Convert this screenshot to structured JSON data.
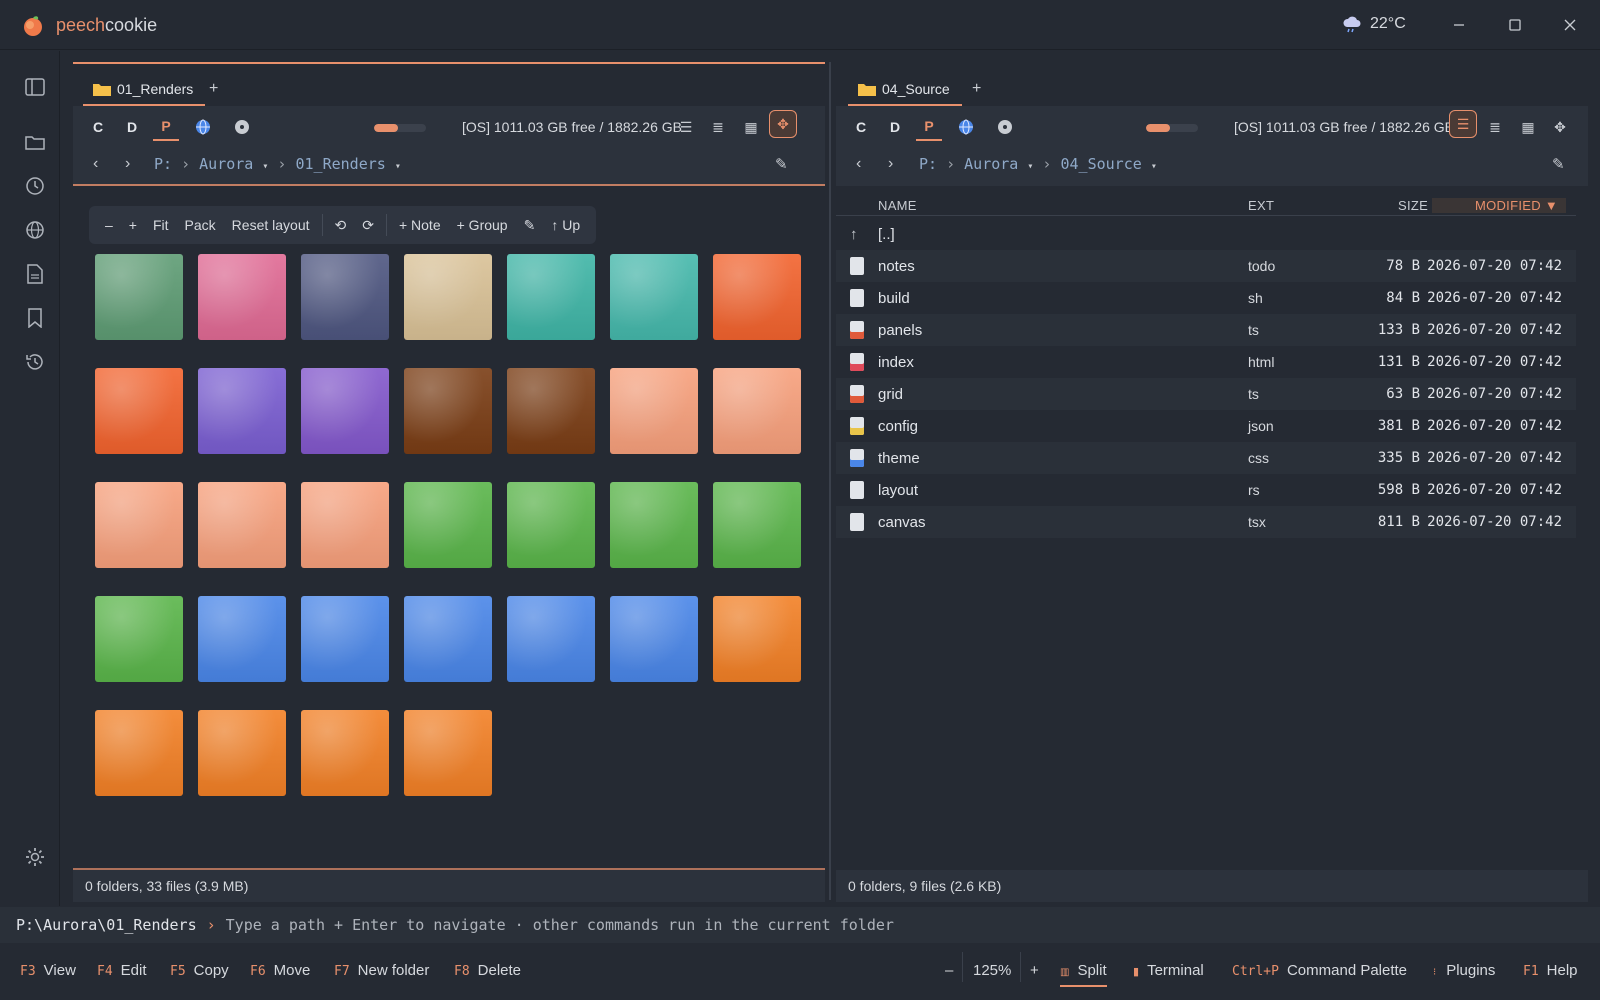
{
  "app": {
    "name_accent": "peech",
    "name_rest": "cookie",
    "weather_temp": "22°C"
  },
  "rail": {
    "items": [
      "sidebar-toggle",
      "folder",
      "recent",
      "network",
      "document",
      "bookmark",
      "history",
      "settings"
    ]
  },
  "left_pane": {
    "tab_label": "01_Renders",
    "tab_add": "+",
    "drives": [
      "C",
      "D",
      "P"
    ],
    "active_drive": "P",
    "disk_usage_fraction": 0.46,
    "free_text": "[OS] 1011.03 GB free / 1882.26 GB",
    "breadcrumb": {
      "root": "P:",
      "parts": [
        "Aurora",
        "01_Renders"
      ]
    },
    "canvas_tools": [
      "–",
      "+",
      "Fit",
      "Pack",
      "Reset layout",
      "+ Note",
      "+ Group",
      "↑ Up"
    ],
    "thumb_colors": [
      "#5e9c74",
      "#e06a94",
      "#4e5680",
      "#d9c196",
      "#3fb5a6",
      "#45b8ab",
      "#f2632e",
      "#f2632e",
      "#7a5ed1",
      "#8358cc",
      "#7a3d15",
      "#7a3d15",
      "#f7a07c",
      "#f7a07c",
      "#f7a07c",
      "#f7a07c",
      "#f7a07c",
      "#5ab54a",
      "#5ab54a",
      "#5ab54a",
      "#5ab54a",
      "#5ab54a",
      "#4a86e8",
      "#4a86e8",
      "#4a86e8",
      "#4a86e8",
      "#4a86e8",
      "#f28026",
      "#f28026",
      "#f28026",
      "#f28026",
      "#f28026"
    ],
    "status": "0 folders, 33 files (3.9 MB)"
  },
  "right_pane": {
    "tab_label": "04_Source",
    "tab_add": "+",
    "drives": [
      "C",
      "D",
      "P"
    ],
    "active_drive": "P",
    "disk_usage_fraction": 0.46,
    "free_text": "[OS] 1011.03 GB free / 1882.26 GB",
    "breadcrumb": {
      "root": "P:",
      "parts": [
        "Aurora",
        "04_Source"
      ]
    },
    "columns": {
      "name": "NAME",
      "ext": "EXT",
      "size": "SIZE",
      "modified": "MODIFIED"
    },
    "up_entry": "[..]",
    "files": [
      {
        "name": "notes",
        "ext": "todo",
        "size": "78 B",
        "modified": "2026-07-20 07:42",
        "icon": "file-icon"
      },
      {
        "name": "build",
        "ext": "sh",
        "size": "84 B",
        "modified": "2026-07-20 07:42",
        "icon": "file-icon"
      },
      {
        "name": "panels",
        "ext": "ts",
        "size": "133 B",
        "modified": "2026-07-20 07:42",
        "icon": "ts-file-icon"
      },
      {
        "name": "index",
        "ext": "html",
        "size": "131 B",
        "modified": "2026-07-20 07:42",
        "icon": "html-file-icon"
      },
      {
        "name": "grid",
        "ext": "ts",
        "size": "63 B",
        "modified": "2026-07-20 07:42",
        "icon": "ts-file-icon"
      },
      {
        "name": "config",
        "ext": "json",
        "size": "381 B",
        "modified": "2026-07-20 07:42",
        "icon": "json-file-icon"
      },
      {
        "name": "theme",
        "ext": "css",
        "size": "335 B",
        "modified": "2026-07-20 07:42",
        "icon": "css-file-icon"
      },
      {
        "name": "layout",
        "ext": "rs",
        "size": "598 B",
        "modified": "2026-07-20 07:42",
        "icon": "file-icon"
      },
      {
        "name": "canvas",
        "ext": "tsx",
        "size": "811 B",
        "modified": "2026-07-20 07:42",
        "icon": "file-icon"
      }
    ],
    "status": "0 folders, 9 files (2.6 KB)"
  },
  "command_line": {
    "path": "P:\\Aurora\\01_Renders",
    "chevron": "›",
    "hint": "Type a path + Enter to navigate · other commands run in the current folder"
  },
  "function_bar": {
    "left": [
      {
        "key": "F3",
        "label": "View"
      },
      {
        "key": "F4",
        "label": "Edit"
      },
      {
        "key": "F5",
        "label": "Copy"
      },
      {
        "key": "F6",
        "label": "Move"
      },
      {
        "key": "F7",
        "label": "New folder"
      },
      {
        "key": "F8",
        "label": "Delete"
      }
    ],
    "zoom_minus": "–",
    "zoom": "125%",
    "zoom_plus": "+",
    "split": "Split",
    "terminal": "Terminal",
    "palette_key": "Ctrl+P",
    "palette": "Command Palette",
    "plugins": "Plugins",
    "help_key": "F1",
    "help": "Help"
  },
  "colors": {
    "accent": "#e8906c",
    "bg": "#252a33",
    "panel": "#2c323c"
  }
}
